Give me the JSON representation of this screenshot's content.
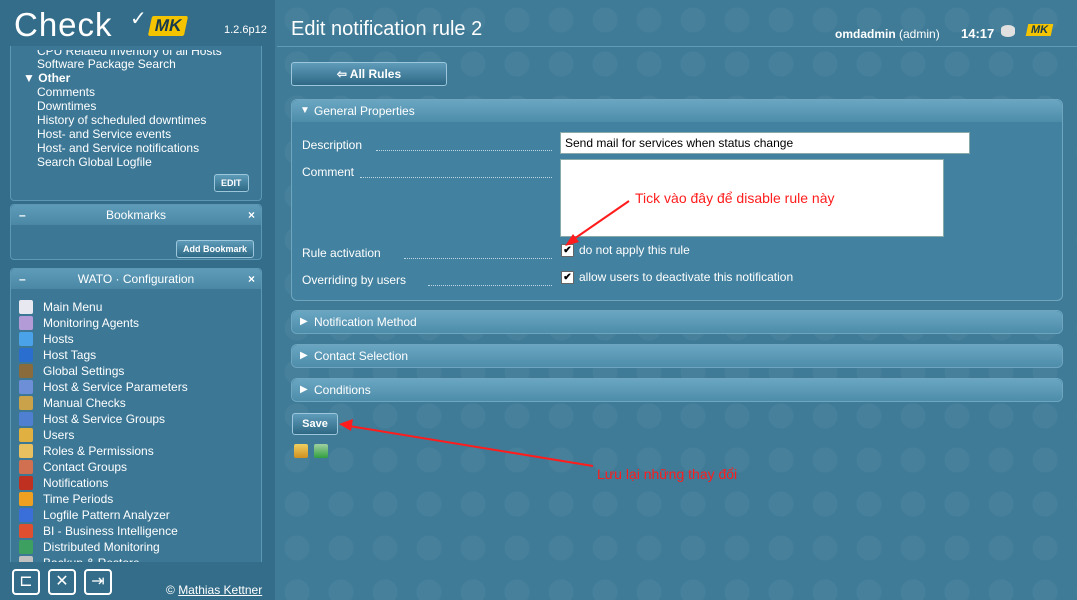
{
  "sidebar": {
    "logo": {
      "word": "Check",
      "mk": "MK",
      "version": "1.2.6p12"
    },
    "views": {
      "cut_line": "CPU Related inventory of all Hosts",
      "items_top": [
        "Software Package Search"
      ],
      "category": "Other",
      "category_arrow": "▼",
      "items": [
        "Comments",
        "Downtimes",
        "History of scheduled downtimes",
        "Host- and Service events",
        "Host- and Service notifications",
        "Search Global Logfile"
      ],
      "edit_label": "EDIT"
    },
    "bookmarks": {
      "title": "Bookmarks",
      "minimize": "–",
      "close": "×",
      "add_label": "Add Bookmark"
    },
    "wato": {
      "title": "WATO · Configuration",
      "minimize": "–",
      "close": "×",
      "items": [
        {
          "label": "Main Menu",
          "icon": "home-icon",
          "color": "#e8e8f0"
        },
        {
          "label": "Monitoring Agents",
          "icon": "agent-icon",
          "color": "#b39bd8"
        },
        {
          "label": "Hosts",
          "icon": "folder-icon",
          "color": "#4aa3e8"
        },
        {
          "label": "Host Tags",
          "icon": "tag-icon",
          "color": "#2a6fd0"
        },
        {
          "label": "Global Settings",
          "icon": "settings-box-icon",
          "color": "#8a6b3c"
        },
        {
          "label": "Host & Service Parameters",
          "icon": "rules-icon",
          "color": "#6d8fd8"
        },
        {
          "label": "Manual Checks",
          "icon": "wrench-icon",
          "color": "#c9a24a"
        },
        {
          "label": "Host & Service Groups",
          "icon": "groups-icon",
          "color": "#4f7fd0"
        },
        {
          "label": "Users",
          "icon": "users-icon",
          "color": "#e0b040"
        },
        {
          "label": "Roles & Permissions",
          "icon": "roles-icon",
          "color": "#e8c060"
        },
        {
          "label": "Contact Groups",
          "icon": "contact-groups-icon",
          "color": "#d07050"
        },
        {
          "label": "Notifications",
          "icon": "notifications-icon",
          "color": "#c03020"
        },
        {
          "label": "Time Periods",
          "icon": "clock-icon",
          "color": "#f0a020"
        },
        {
          "label": "Logfile Pattern Analyzer",
          "icon": "logfile-icon",
          "color": "#3a6ed8"
        },
        {
          "label": "BI - Business Intelligence",
          "icon": "bi-icon",
          "color": "#e05030"
        },
        {
          "label": "Distributed Monitoring",
          "icon": "globe-icon",
          "color": "#3ea060"
        },
        {
          "label": "Backup & Restore",
          "icon": "backup-icon",
          "color": "#c0c0c0"
        }
      ]
    },
    "footer": {
      "copyright_symbol": "©",
      "copyright_name": "Mathias Kettner"
    }
  },
  "header": {
    "title": "Edit notification rule 2",
    "user": "omdadmin",
    "role": "(admin)",
    "time": "14:17",
    "mk_badge": "MK"
  },
  "main": {
    "all_rules_label": "All Rules",
    "all_rules_arrow": "⇦",
    "general": {
      "title": "General Properties",
      "arrow": "▼",
      "description_label": "Description",
      "description_value": "Send mail for services when status change",
      "comment_label": "Comment",
      "rule_activation_label": "Rule activation",
      "rule_activation_checkbox": "do not apply this rule",
      "rule_activation_checked": true,
      "overriding_label": "Overriding by users",
      "overriding_checkbox": "allow users to deactivate this notification",
      "overriding_checked": true
    },
    "sections": [
      {
        "title": "Notification Method",
        "arrow": "▶"
      },
      {
        "title": "Contact Selection",
        "arrow": "▶"
      },
      {
        "title": "Conditions",
        "arrow": "▶"
      }
    ],
    "save_label": "Save",
    "annotations": {
      "disable_note": "Tick vào đây để disable rule này",
      "save_note": "Lưu lại những thay đổi"
    }
  }
}
